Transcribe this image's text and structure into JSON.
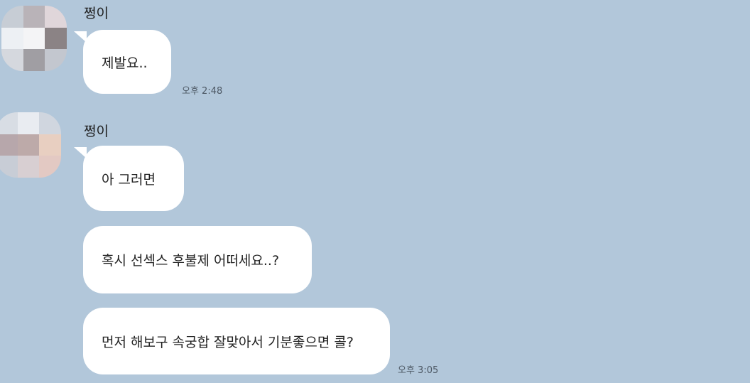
{
  "messages": [
    {
      "sender": "쩡이",
      "bubbles": [
        "제발요.."
      ],
      "time": "오후 2:48"
    },
    {
      "sender": "쩡이",
      "bubbles": [
        "아 그러면",
        "혹시 선섹스 후불제 어떠세요..?",
        "먼저 해보구 속궁합 잘맞아서 기분좋으면 콜?"
      ],
      "time": "오후 3:05"
    }
  ],
  "colors": {
    "background": "#b2c7da",
    "bubble": "#ffffff"
  }
}
